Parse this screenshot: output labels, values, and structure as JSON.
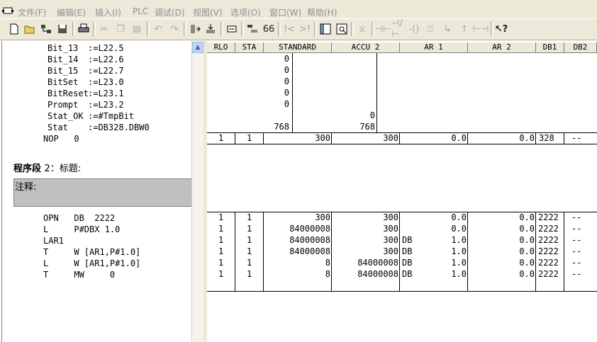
{
  "menu": [
    "文件(F)",
    "编辑(E)",
    "插入(I)",
    "PLC",
    "调试(D)",
    "视图(V)",
    "选项(O)",
    "窗口(W)",
    "帮助(H)"
  ],
  "toolbar_icons": [
    "new-icon",
    "open-icon",
    "network-icon",
    "save-icon",
    "print-icon",
    "cut-icon",
    "copy-icon",
    "paste-icon",
    "undo-icon",
    "redo-icon",
    "load-icon",
    "download-icon",
    "monitor-icon",
    "overview-icon",
    "glasses-icon",
    "comment-open-icon",
    "comment-close-icon",
    "ladder-icon",
    "zoom-icon",
    "bit-icon",
    "contact-no-icon",
    "contact-nc-icon",
    "coil-icon",
    "box-icon",
    "branch-open-icon",
    "branch-close-icon",
    "connector-icon",
    "help-icon"
  ],
  "code_top": [
    [
      "Bit_13",
      ":=L22.5"
    ],
    [
      "Bit_14",
      ":=L22.6"
    ],
    [
      "Bit_15",
      ":=L22.7"
    ],
    [
      "BitSet",
      ":=L23.0"
    ],
    [
      "BitReset",
      ":=L23.1"
    ],
    [
      "Prompt",
      ":=L23.2"
    ],
    [
      "Stat_OK",
      ":=#TmpBit"
    ],
    [
      "Stat",
      ":=DB328.DBW0"
    ]
  ],
  "nop_line": "NOP   0",
  "segment": {
    "title": "程序段",
    "number": "2",
    "label": "：标题:"
  },
  "comment_label": "注释:",
  "code_bottom": [
    "OPN   DB  2222",
    "L     P#DBX 1.0",
    "LAR1",
    "T     W [AR1,P#1.0]",
    "L     W [AR1,P#1.0]",
    "T     MW     0"
  ],
  "columns": [
    "RLO",
    "STA",
    "STANDARD",
    "ACCU 2",
    "AR 1",
    "AR 2",
    "DB1",
    "DB2"
  ],
  "top_block": {
    "standard_vals": [
      "0",
      "0",
      "0",
      "0",
      "0",
      "",
      "768"
    ],
    "accu2_vals": [
      "",
      "",
      "",
      "",
      "",
      "0",
      "768"
    ]
  },
  "nop_row": [
    "1",
    "1",
    "300",
    "300",
    "0.0",
    "0.0",
    "328",
    "--"
  ],
  "rows": [
    [
      "1",
      "1",
      "300",
      "300",
      "",
      "0.0",
      "0.0",
      "2222",
      "--"
    ],
    [
      "1",
      "1",
      "84000008",
      "300",
      "",
      "0.0",
      "0.0",
      "2222",
      "--"
    ],
    [
      "1",
      "1",
      "84000008",
      "300",
      "DB",
      "1.0",
      "0.0",
      "2222",
      "--"
    ],
    [
      "1",
      "1",
      "84000008",
      "300",
      "DB",
      "1.0",
      "0.0",
      "2222",
      "--"
    ],
    [
      "1",
      "1",
      "8",
      "84000008",
      "DB",
      "1.0",
      "0.0",
      "2222",
      "--"
    ],
    [
      "1",
      "1",
      "8",
      "84000008",
      "DB",
      "1.0",
      "0.0",
      "2222",
      "--"
    ]
  ]
}
